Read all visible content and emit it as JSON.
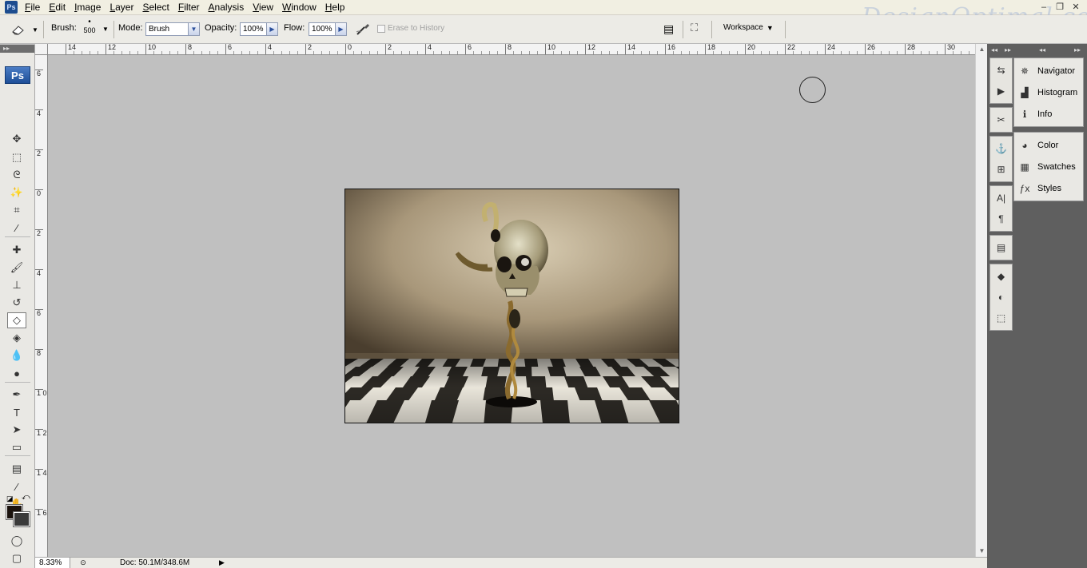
{
  "app": {
    "icon_label": "Ps",
    "watermark": "DesignOptimal.com"
  },
  "menu": [
    "File",
    "Edit",
    "Image",
    "Layer",
    "Select",
    "Filter",
    "Analysis",
    "View",
    "Window",
    "Help"
  ],
  "window_controls": {
    "minimize": "–",
    "restore": "❐",
    "close": "✕"
  },
  "options": {
    "brush_label": "Brush:",
    "brush_size": "500",
    "mode_label": "Mode:",
    "mode_value": "Brush",
    "opacity_label": "Opacity:",
    "opacity_value": "100%",
    "flow_label": "Flow:",
    "flow_value": "100%",
    "erase_history": "Erase to History",
    "workspace_label": "Workspace"
  },
  "toolbox": {
    "logo": "Ps",
    "tools": [
      {
        "name": "move-tool",
        "glyph": "✥"
      },
      {
        "name": "marquee-tool",
        "glyph": "⬚"
      },
      {
        "name": "lasso-tool",
        "glyph": "ᘓ"
      },
      {
        "name": "magic-wand-tool",
        "glyph": "✨"
      },
      {
        "name": "crop-tool",
        "glyph": "⌗"
      },
      {
        "name": "eyedropper-tool",
        "glyph": "⁄"
      },
      {
        "name": "healing-brush-tool",
        "glyph": "✚"
      },
      {
        "name": "brush-tool",
        "glyph": "🖌"
      },
      {
        "name": "clone-stamp-tool",
        "glyph": "⊥"
      },
      {
        "name": "history-brush-tool",
        "glyph": "↺"
      },
      {
        "name": "eraser-tool",
        "glyph": "◇"
      },
      {
        "name": "paint-bucket-tool",
        "glyph": "◈"
      },
      {
        "name": "blur-tool",
        "glyph": "💧"
      },
      {
        "name": "dodge-tool",
        "glyph": "●"
      },
      {
        "name": "pen-tool",
        "glyph": "✒"
      },
      {
        "name": "type-tool",
        "glyph": "T"
      },
      {
        "name": "path-selection-tool",
        "glyph": "➤"
      },
      {
        "name": "rectangle-tool",
        "glyph": "▭"
      },
      {
        "name": "notes-tool",
        "glyph": "▤"
      },
      {
        "name": "eyedropper2-tool",
        "glyph": "⁄"
      },
      {
        "name": "hand-tool",
        "glyph": "✋"
      },
      {
        "name": "zoom-tool",
        "glyph": "⚲"
      }
    ],
    "quick_mask": "◯",
    "screen_mode": "▢"
  },
  "ruler_h_labels": [
    "14",
    "12",
    "10",
    "8",
    "6",
    "4",
    "2",
    "0",
    "2",
    "4",
    "6",
    "8",
    "10",
    "12",
    "14",
    "16",
    "18",
    "20",
    "22",
    "24",
    "26",
    "28",
    "30"
  ],
  "ruler_v_labels": [
    "6",
    "4",
    "2",
    "0",
    "2",
    "4",
    "6",
    "8",
    "1 0",
    "1 2",
    "1 4",
    "1 6"
  ],
  "status": {
    "zoom": "8.33%",
    "doc_info": "Doc: 50.1M/348.6M"
  },
  "panels": {
    "group1": [
      {
        "name": "Navigator",
        "icon": "navigator-icon",
        "glyph": "✵"
      },
      {
        "name": "Histogram",
        "icon": "histogram-icon",
        "glyph": "▟"
      },
      {
        "name": "Info",
        "icon": "info-icon",
        "glyph": "ℹ"
      }
    ],
    "group2": [
      {
        "name": "Color",
        "icon": "color-icon",
        "glyph": "◕"
      },
      {
        "name": "Swatches",
        "icon": "swatches-icon",
        "glyph": "▦"
      },
      {
        "name": "Styles",
        "icon": "styles-icon",
        "glyph": "ƒx"
      }
    ]
  },
  "icon_strip": [
    [
      "⇆",
      "▶"
    ],
    [
      "✂"
    ],
    [
      "⚓",
      "⊞"
    ],
    [
      "A|",
      "¶"
    ],
    [
      "▤"
    ],
    [
      "◆",
      "◐",
      "⬚"
    ]
  ]
}
